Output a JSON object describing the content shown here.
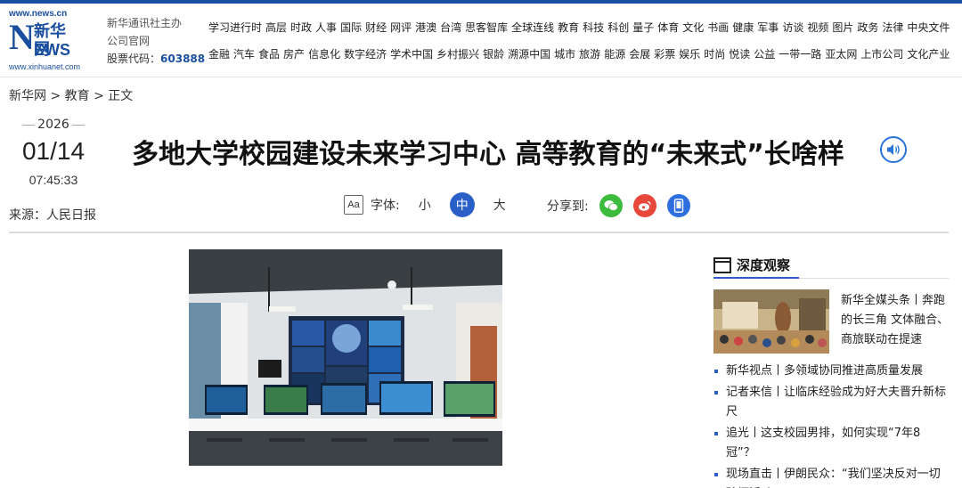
{
  "logo": {
    "url_top": "www.news.cn",
    "mark_n": "N",
    "mark_cn": "新华网",
    "mark_ews": "EWS",
    "url_bottom": "www.xinhuanet.com"
  },
  "corp": {
    "line1": "新华通讯社主办",
    "line2": "公司官网",
    "code_label": "股票代码：",
    "code": "603888"
  },
  "nav": {
    "row1": [
      "学习进行时",
      "高层",
      "时政",
      "人事",
      "国际",
      "财经",
      "网评",
      "港澳",
      "台湾",
      "思客智库",
      "全球连线",
      "教育",
      "科技",
      "科创",
      "量子",
      "体育",
      "文化",
      "书画",
      "健康",
      "军事",
      "访谈",
      "视频",
      "图片",
      "政务",
      "法律",
      "中央文件"
    ],
    "row2": [
      "金融",
      "汽车",
      "食品",
      "房产",
      "信息化",
      "数字经济",
      "学术中国",
      "乡村振兴",
      "银龄",
      "溯源中国",
      "城市",
      "旅游",
      "能源",
      "会展",
      "彩票",
      "娱乐",
      "时尚",
      "悦读",
      "公益",
      "一带一路",
      "亚太网",
      "上市公司",
      "文化产业"
    ]
  },
  "breadcrumb": "新华网 > 教育 > 正文",
  "date": {
    "year": "2026",
    "day": "01/14",
    "time": "07:45:33"
  },
  "source": "来源：人民日报",
  "title": "多地大学校园建设未来学习中心 高等教育的“未来式”长啥样",
  "font_control": {
    "label": "字体:",
    "small": "小",
    "medium": "中",
    "large": "大",
    "icon_text": "Aa"
  },
  "share": {
    "label": "分享到:"
  },
  "sidebar": {
    "heading": "深度观察",
    "feature_text": "新华全媒头条丨奔跑的长三角 文体融合、商旅联动在提速",
    "items": [
      "新华视点丨多领域协同推进高质量发展",
      "记者来信丨让临床经验成为好大夫晋升新标尺",
      "追光丨这支校园男排，如何实现“7年8冠”？",
      "现场直击丨伊朗民众：“我们坚决反对一切破坏活动”"
    ]
  },
  "colors": {
    "brand": "#1a4fa0",
    "accent": "#2a5fc7",
    "wechat": "#3cbb3c",
    "weibo": "#e8483b"
  }
}
